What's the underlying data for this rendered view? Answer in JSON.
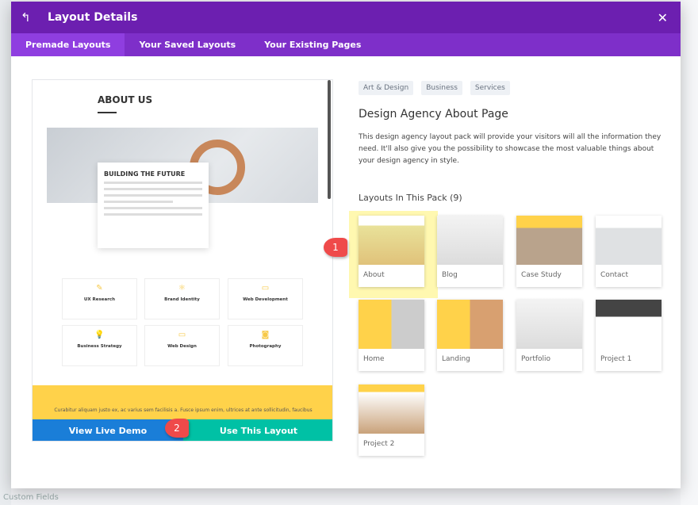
{
  "modal": {
    "title": "Layout Details",
    "back_icon": "undo-arrow-icon",
    "close_icon": "close-icon"
  },
  "tabs": [
    {
      "label": "Premade Layouts",
      "active": true
    },
    {
      "label": "Your Saved Layouts"
    },
    {
      "label": "Your Existing Pages"
    }
  ],
  "preview": {
    "heading": "ABOUT US",
    "card_title": "BUILDING THE FUTURE",
    "services": [
      {
        "name": "UX Research",
        "icon": "pencil-square-icon"
      },
      {
        "name": "Brand Identity",
        "icon": "atom-icon"
      },
      {
        "name": "Web Development",
        "icon": "monitor-icon"
      },
      {
        "name": "Business Strategy",
        "icon": "lightbulb-icon"
      },
      {
        "name": "Web Design",
        "icon": "laptop-icon"
      },
      {
        "name": "Photography",
        "icon": "camera-icon"
      }
    ],
    "footer_text": "Curabitur aliquam justo ex, ac varius sem facilisis a. Fusce ipsum enim, ultrices at ante sollicitudin, faucibus",
    "view_demo": "View Live Demo",
    "use_layout": "Use This Layout"
  },
  "details": {
    "tags": [
      "Art & Design",
      "Business",
      "Services"
    ],
    "title": "Design Agency About Page",
    "description": "This design agency layout pack will provide your visitors will all the information they need. It'll also give you the possibility to showcase the most valuable things about your design agency in style.",
    "pack_heading": "Layouts In This Pack (9)",
    "layouts": [
      "About",
      "Blog",
      "Case Study",
      "Contact",
      "Home",
      "Landing",
      "Portfolio",
      "Project 1",
      "Project 2"
    ],
    "selected": "About"
  },
  "annotations": [
    "1",
    "2"
  ],
  "background": {
    "bottom_text": "Custom Fields"
  },
  "colors": {
    "header": "#6c1fb0",
    "tabs": "#7e2fc9",
    "demo": "#1a7ed8",
    "use": "#00c1a5",
    "accent": "#ffd24a",
    "badge": "#ef4a4a"
  }
}
